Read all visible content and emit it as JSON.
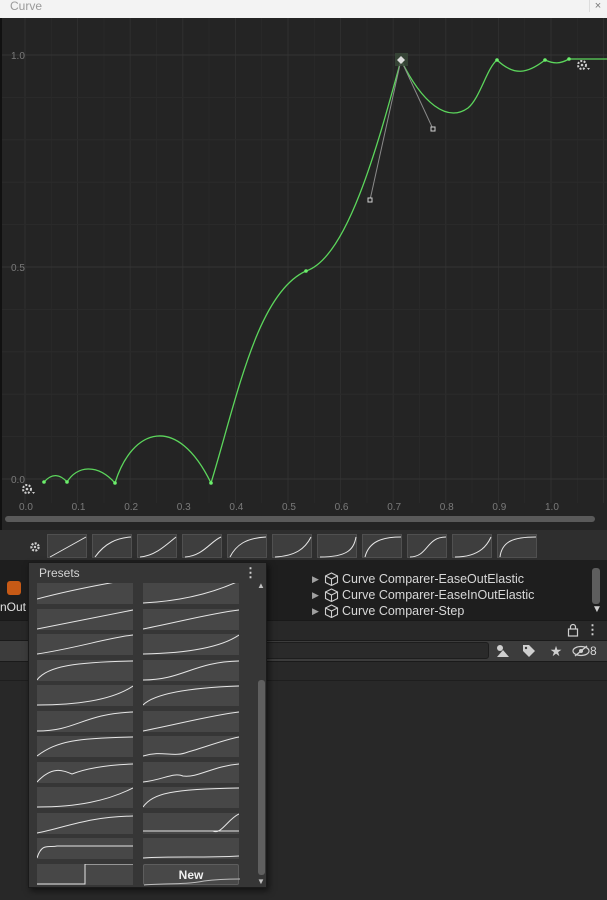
{
  "window": {
    "title": "Curve",
    "close_label": "×"
  },
  "graph": {
    "y_labels": [
      "1.0",
      "0.5",
      "0.0"
    ],
    "x_labels": [
      "0.0",
      "0.1",
      "0.2",
      "0.3",
      "0.4",
      "0.5",
      "0.6",
      "0.7",
      "0.8",
      "0.9",
      "1.0"
    ],
    "curve_color": "#5cd65c",
    "key_color": "#6cef6c",
    "selected_key_color": "#dcdcdc"
  },
  "presets_popup": {
    "title": "Presets",
    "new_label": "New"
  },
  "hierarchy": {
    "items": [
      "Curve Comparer-EaseOutElastic",
      "Curve Comparer-EaseInOutElastic",
      "Curve Comparer-Step"
    ]
  },
  "background_text": {
    "cut_label": "nOut"
  },
  "toolbar": {
    "hidden_count": "8"
  },
  "colors": {
    "accent_orange": "#c75a16",
    "panel": "#282828"
  }
}
